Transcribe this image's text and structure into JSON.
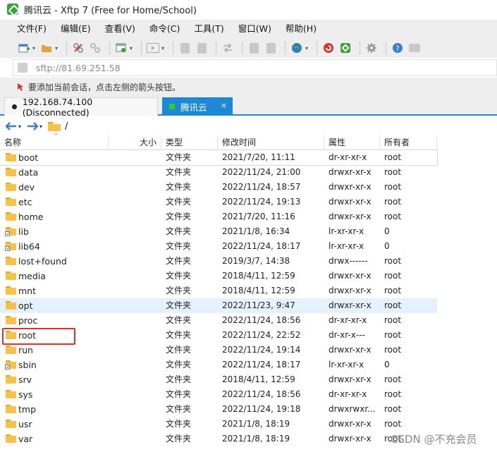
{
  "window": {
    "title": "腾讯云 - Xftp 7 (Free for Home/School)"
  },
  "menu": [
    "文件(F)",
    "编辑(E)",
    "查看(V)",
    "命令(C)",
    "工具(T)",
    "窗口(W)",
    "帮助(H)"
  ],
  "address": {
    "text": "sftp://81.69.251.58"
  },
  "hint": {
    "text": "要添加当前会话，点击左侧的箭头按钮。"
  },
  "tabs": [
    {
      "label": "192.168.74.100 (Disconnected)"
    },
    {
      "label": "腾讯云",
      "close": "×"
    }
  ],
  "nav": {
    "path": "/"
  },
  "columns": [
    "名称",
    "大小",
    "类型",
    "修改时间",
    "属性",
    "所有者"
  ],
  "files": [
    {
      "name": "boot",
      "size": "",
      "type": "文件夹",
      "modified": "2021/7/20, 11:11",
      "perm": "dr-xr-xr-x",
      "owner": "root"
    },
    {
      "name": "data",
      "size": "",
      "type": "文件夹",
      "modified": "2022/11/24, 21:00",
      "perm": "drwxr-xr-x",
      "owner": "root"
    },
    {
      "name": "dev",
      "size": "",
      "type": "文件夹",
      "modified": "2022/11/24, 18:57",
      "perm": "drwxr-xr-x",
      "owner": "root"
    },
    {
      "name": "etc",
      "size": "",
      "type": "文件夹",
      "modified": "2022/11/24, 19:13",
      "perm": "drwxr-xr-x",
      "owner": "root"
    },
    {
      "name": "home",
      "size": "",
      "type": "文件夹",
      "modified": "2021/7/20, 11:16",
      "perm": "drwxr-xr-x",
      "owner": "root"
    },
    {
      "name": "lib",
      "size": "",
      "type": "文件夹",
      "modified": "2021/1/8, 16:34",
      "perm": "lr-xr-xr-x",
      "owner": "0"
    },
    {
      "name": "lib64",
      "size": "",
      "type": "文件夹",
      "modified": "2022/11/24, 18:17",
      "perm": "lr-xr-xr-x",
      "owner": "0"
    },
    {
      "name": "lost+found",
      "size": "",
      "type": "文件夹",
      "modified": "2019/3/7, 14:38",
      "perm": "drwx------",
      "owner": "root"
    },
    {
      "name": "media",
      "size": "",
      "type": "文件夹",
      "modified": "2018/4/11, 12:59",
      "perm": "drwxr-xr-x",
      "owner": "root"
    },
    {
      "name": "mnt",
      "size": "",
      "type": "文件夹",
      "modified": "2018/4/11, 12:59",
      "perm": "drwxr-xr-x",
      "owner": "root"
    },
    {
      "name": "opt",
      "size": "",
      "type": "文件夹",
      "modified": "2022/11/23, 9:47",
      "perm": "drwxr-xr-x",
      "owner": "root"
    },
    {
      "name": "proc",
      "size": "",
      "type": "文件夹",
      "modified": "2022/11/24, 18:56",
      "perm": "dr-xr-xr-x",
      "owner": "root"
    },
    {
      "name": "root",
      "size": "",
      "type": "文件夹",
      "modified": "2022/11/24, 22:52",
      "perm": "dr-xr-x---",
      "owner": "root"
    },
    {
      "name": "run",
      "size": "",
      "type": "文件夹",
      "modified": "2022/11/24, 19:14",
      "perm": "drwxr-xr-x",
      "owner": "root"
    },
    {
      "name": "sbin",
      "size": "",
      "type": "文件夹",
      "modified": "2022/11/24, 18:17",
      "perm": "lr-xr-xr-x",
      "owner": "0"
    },
    {
      "name": "srv",
      "size": "",
      "type": "文件夹",
      "modified": "2018/4/11, 12:59",
      "perm": "drwxr-xr-x",
      "owner": "root"
    },
    {
      "name": "sys",
      "size": "",
      "type": "文件夹",
      "modified": "2022/11/24, 18:56",
      "perm": "dr-xr-xr-x",
      "owner": "root"
    },
    {
      "name": "tmp",
      "size": "",
      "type": "文件夹",
      "modified": "2022/11/24, 19:18",
      "perm": "drwxrwxr...",
      "owner": "root"
    },
    {
      "name": "usr",
      "size": "",
      "type": "文件夹",
      "modified": "2021/1/8, 18:19",
      "perm": "drwxr-xr-x",
      "owner": "root"
    },
    {
      "name": "var",
      "size": "",
      "type": "文件夹",
      "modified": "2021/1/8, 18:19",
      "perm": "drwxr-xr-x",
      "owner": "root"
    }
  ],
  "watermark": "CSDN @不充会员",
  "colors": {
    "accent": "#1e88d7",
    "folder": "#f6c24a",
    "highlight_box": "#e0302b",
    "row_hover": "#e6f2fb"
  }
}
